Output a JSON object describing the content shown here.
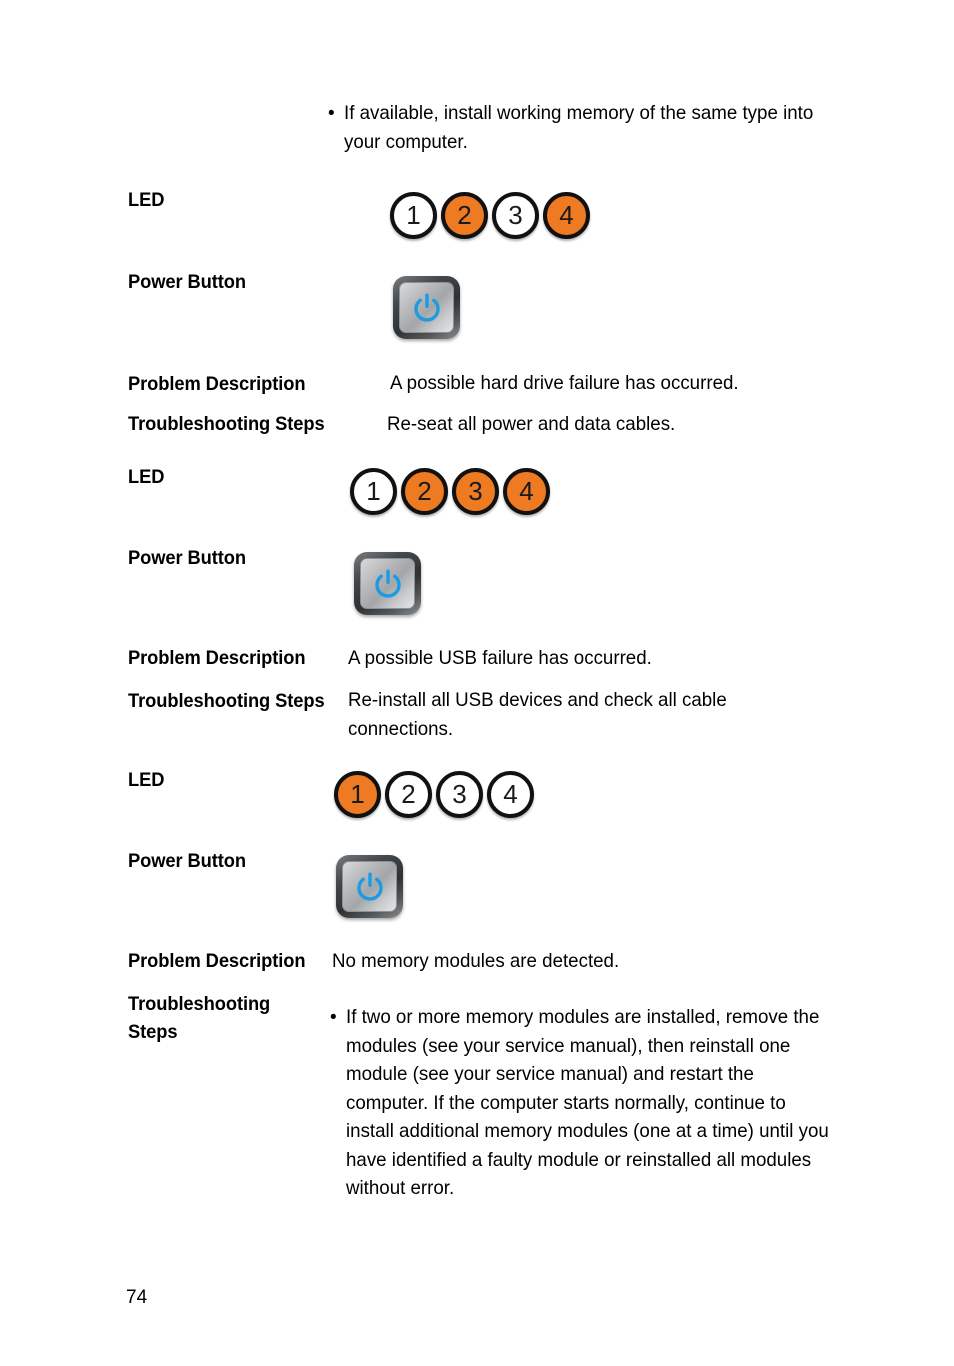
{
  "document": {
    "page_number": "74",
    "labels": {
      "led": "LED",
      "power_button": "Power Button",
      "problem_description": "Problem Description",
      "troubleshooting_steps": "Troubleshooting Steps",
      "troubleshooting_steps_wrapped": "Troubleshooting\nSteps"
    },
    "icons": {
      "bullet": "•",
      "power_symbol": "power-symbol-icon"
    }
  },
  "intro_bullet": {
    "marker": "•",
    "text": "If available, install working memory of the same type into your computer."
  },
  "sections": [
    {
      "led_label": "LED",
      "leds": [
        {
          "number": "1",
          "state": "off"
        },
        {
          "number": "2",
          "state": "on"
        },
        {
          "number": "3",
          "state": "off"
        },
        {
          "number": "4",
          "state": "on"
        }
      ],
      "power_button_label": "Power Button",
      "power_button_state": "on",
      "problem_label": "Problem Description",
      "problem_text": "A possible hard drive failure has occurred.",
      "steps_label": "Troubleshooting Steps",
      "steps_text": "Re-seat all power and data cables."
    },
    {
      "led_label": "LED",
      "leds": [
        {
          "number": "1",
          "state": "off"
        },
        {
          "number": "2",
          "state": "on"
        },
        {
          "number": "3",
          "state": "on"
        },
        {
          "number": "4",
          "state": "on"
        }
      ],
      "power_button_label": "Power Button",
      "power_button_state": "on",
      "problem_label": "Problem Description",
      "problem_text": "A possible USB failure has occurred.",
      "steps_label": "Troubleshooting Steps",
      "steps_text": "Re-install all USB devices and check all cable connections."
    },
    {
      "led_label": "LED",
      "leds": [
        {
          "number": "1",
          "state": "on"
        },
        {
          "number": "2",
          "state": "off"
        },
        {
          "number": "3",
          "state": "off"
        },
        {
          "number": "4",
          "state": "off"
        }
      ],
      "power_button_label": "Power Button",
      "power_button_state": "on",
      "problem_label": "Problem Description",
      "problem_text": "No memory modules are detected.",
      "steps_label": "Troubleshooting\nSteps",
      "steps_bullet_marker": "•",
      "steps_bullet_text": "If two or more memory modules are installed, remove the modules (see your service manual), then reinstall one module (see your service manual) and restart the computer. If the computer starts normally, continue to install additional memory modules (one at a time) until you have identified a faulty module or reinstalled all modules without error."
    }
  ],
  "colors": {
    "led_on": "#ee7a22",
    "led_off": "#ffffff",
    "led_border": "#111111",
    "power_icon_blue": "#1e9be0",
    "text": "#000000",
    "background": "#ffffff"
  }
}
